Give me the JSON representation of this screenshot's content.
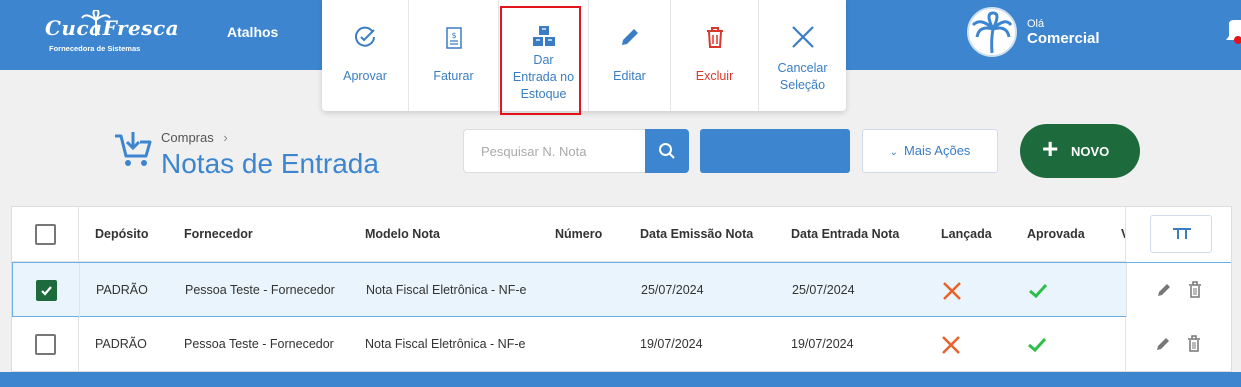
{
  "brand": {
    "logo_title": "CucaFresca",
    "logo_subtitle": "Fornecedora de Sistemas"
  },
  "nav": {
    "shortcuts_label": "Atalhos"
  },
  "user": {
    "greeting": "Olá",
    "name": "Comercial"
  },
  "actions": [
    {
      "label_lines": [
        "Aprovar"
      ],
      "icon": "check-circle-icon"
    },
    {
      "label_lines": [
        "Faturar"
      ],
      "icon": "invoice-icon"
    },
    {
      "label_lines": [
        "Dar",
        "Entrada no",
        "Estoque"
      ],
      "icon": "boxes-icon"
    },
    {
      "label_lines": [
        "Editar"
      ],
      "icon": "pencil-icon"
    },
    {
      "label_lines": [
        "Excluir"
      ],
      "icon": "trash-icon"
    },
    {
      "label_lines": [
        "Cancelar",
        "Seleção"
      ],
      "icon": "close-icon"
    }
  ],
  "page": {
    "breadcrumb": "Compras",
    "title": "Notas de Entrada"
  },
  "toolbar": {
    "search_placeholder": "Pesquisar N. Nota",
    "more_actions_label": "Mais Ações",
    "new_label": "NOVO"
  },
  "table": {
    "columns": [
      "Depósito",
      "Fornecedor",
      "Modelo Nota",
      "Número",
      "Data Emissão Nota",
      "Data Entrada Nota",
      "Lançada",
      "Aprovada",
      "V"
    ],
    "rows": [
      {
        "selected": true,
        "deposito": "PADRÃO",
        "fornecedor": "Pessoa Teste - Fornecedor",
        "modelo": "Nota Fiscal Eletrônica - NF-e",
        "numero": "",
        "emissao": "25/07/2024",
        "entrada": "25/07/2024",
        "lancada": false,
        "aprovada": true
      },
      {
        "selected": false,
        "deposito": "PADRÃO",
        "fornecedor": "Pessoa Teste - Fornecedor",
        "modelo": "Nota Fiscal Eletrônica - NF-e",
        "numero": "",
        "emissao": "19/07/2024",
        "entrada": "19/07/2024",
        "lancada": false,
        "aprovada": true
      }
    ]
  },
  "colors": {
    "primary": "#3d86cf",
    "success": "#1d6b3c",
    "danger": "#d9382b",
    "cross": "#e8622a",
    "check": "#2dbe4c"
  }
}
